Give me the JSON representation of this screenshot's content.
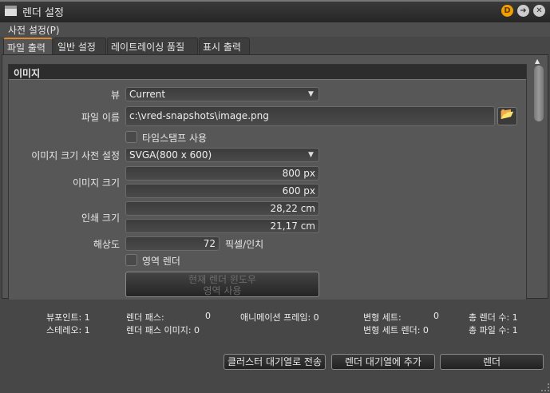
{
  "window": {
    "title": "렌더 설정",
    "icons": [
      "clapperboard-icon",
      "d-badge-icon",
      "arrow-right-icon",
      "close-icon"
    ]
  },
  "menu": {
    "presets": "사전 설정(P)"
  },
  "tabs": [
    "파일 출력",
    "일반 설정",
    "레이트레이싱 품질",
    "표시 출력"
  ],
  "group": {
    "title": "이미지"
  },
  "form": {
    "view_label": "뷰",
    "view_value": "Current",
    "filename_label": "파일 이름",
    "filename_value": "c:\\vred-snapshots\\image.png",
    "timestamp_label": "타임스탬프 사용",
    "timestamp_checked": false,
    "preset_label": "이미지 크기 사전 설정",
    "preset_value": "SVGA(800 x 600)",
    "image_size_label": "이미지 크기",
    "width_value": "800 px",
    "height_value": "600 px",
    "print_size_label": "인쇄 크기",
    "print_width": "28,22 cm",
    "print_height": "21,17 cm",
    "resolution_label": "해상도",
    "resolution_value": "72",
    "resolution_unit": "픽셀/인치",
    "region_label": "영역 렌더",
    "region_checked": false,
    "region_button_line1": "현재 렌더 윈도우",
    "region_button_line2": "영역 사용"
  },
  "stats": {
    "viewpoint": "뷰포인트: 1",
    "stereo": "스테레오: 1",
    "render_pass_label": "렌더 패스:",
    "render_pass_value": "0",
    "render_pass_images": "렌더 패스 이미지: 0",
    "animation_frames": "애니메이션 프레임: 0",
    "variant_sets_label": "변형 세트:",
    "variant_sets_value": "0",
    "variant_set_renders": "변형 세트 렌더: 0",
    "total_renders": "총 렌더 수: 1",
    "total_files": "총 파일 수: 1"
  },
  "buttons": {
    "cluster": "클러스터 대기열로 전송",
    "queue": "렌더 대기열에 추가",
    "render": "렌더"
  }
}
